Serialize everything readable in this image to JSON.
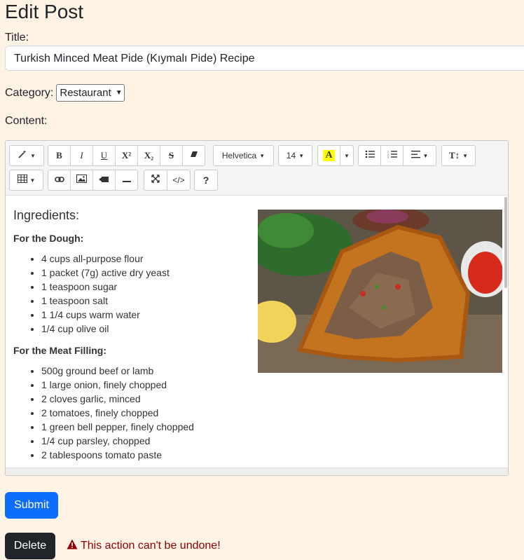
{
  "page": {
    "heading": "Edit Post"
  },
  "form": {
    "title_label": "Title:",
    "title_value": "Turkish Minced Meat Pide (Kıymalı Pide) Recipe",
    "category_label": "Category:",
    "category_value": "Restaurant",
    "content_label": "Content:"
  },
  "toolbar": {
    "bold": "B",
    "italic": "I",
    "underline": "U",
    "superscript": "X²",
    "subscript": "X₂",
    "strikethrough": "S",
    "font_name": "Helvetica",
    "font_size": "14",
    "color_letter": "A",
    "height": "T↕",
    "help": "?"
  },
  "content": {
    "heading": "Ingredients:",
    "dough_title": "For the Dough:",
    "dough_items": [
      "4 cups all-purpose flour",
      "1 packet (7g) active dry yeast",
      "1 teaspoon sugar",
      "1 teaspoon salt",
      "1 1/4 cups warm water",
      "1/4 cup olive oil"
    ],
    "filling_title": "For the Meat Filling:",
    "filling_items": [
      "500g ground beef or lamb",
      "1 large onion, finely chopped",
      "2 cloves garlic, minced",
      "2 tomatoes, finely chopped",
      "1 green bell pepper, finely chopped",
      "1/4 cup parsley, chopped",
      "2 tablespoons tomato paste"
    ]
  },
  "actions": {
    "submit": "Submit",
    "delete": "Delete",
    "warning": "This action can't be undone!"
  },
  "colors": {
    "background": "#fff3e6",
    "primary": "#0d6efd",
    "dark": "#212529",
    "danger": "#8b0000",
    "highlight": "#ffff00"
  }
}
